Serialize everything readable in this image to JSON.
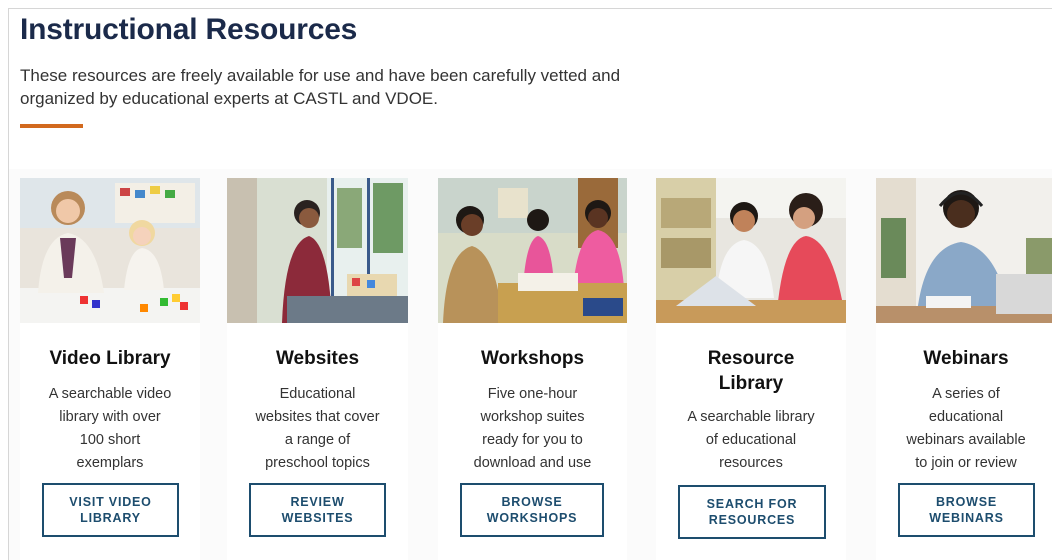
{
  "page": {
    "title": "Instructional Resources",
    "intro_line1": "These resources are freely available for use and have been carefully vetted and",
    "intro_line2": "organized by educational experts at CASTL and VDOE.",
    "accent_color": "#d2691e",
    "title_color": "#1b2a4a",
    "button_color": "#1d4d6e"
  },
  "cards": [
    {
      "title": "Video Library",
      "desc": [
        "A searchable video",
        "library with over",
        "100 short",
        "exemplars"
      ],
      "button": [
        "VISIT VIDEO",
        "LIBRARY"
      ]
    },
    {
      "title": "Websites",
      "desc": [
        "Educational",
        "websites that cover",
        "a range of",
        "preschool topics"
      ],
      "button": [
        "REVIEW",
        "WEBSITES"
      ]
    },
    {
      "title": "Workshops",
      "desc": [
        "Five one-hour",
        "workshop suites",
        "ready for you to",
        "download and use"
      ],
      "button": [
        "BROWSE",
        "WORKSHOPS"
      ]
    },
    {
      "title": "Resource Library",
      "title_lines": [
        "Resource",
        "Library"
      ],
      "desc": [
        "A searchable library",
        "of educational",
        "resources"
      ],
      "button": [
        "SEARCH FOR",
        "RESOURCES"
      ]
    },
    {
      "title": "Webinars",
      "desc": [
        "A series of",
        "educational",
        "webinars available",
        "to join or review"
      ],
      "button": [
        "BROWSE",
        "WEBINARS"
      ]
    }
  ]
}
